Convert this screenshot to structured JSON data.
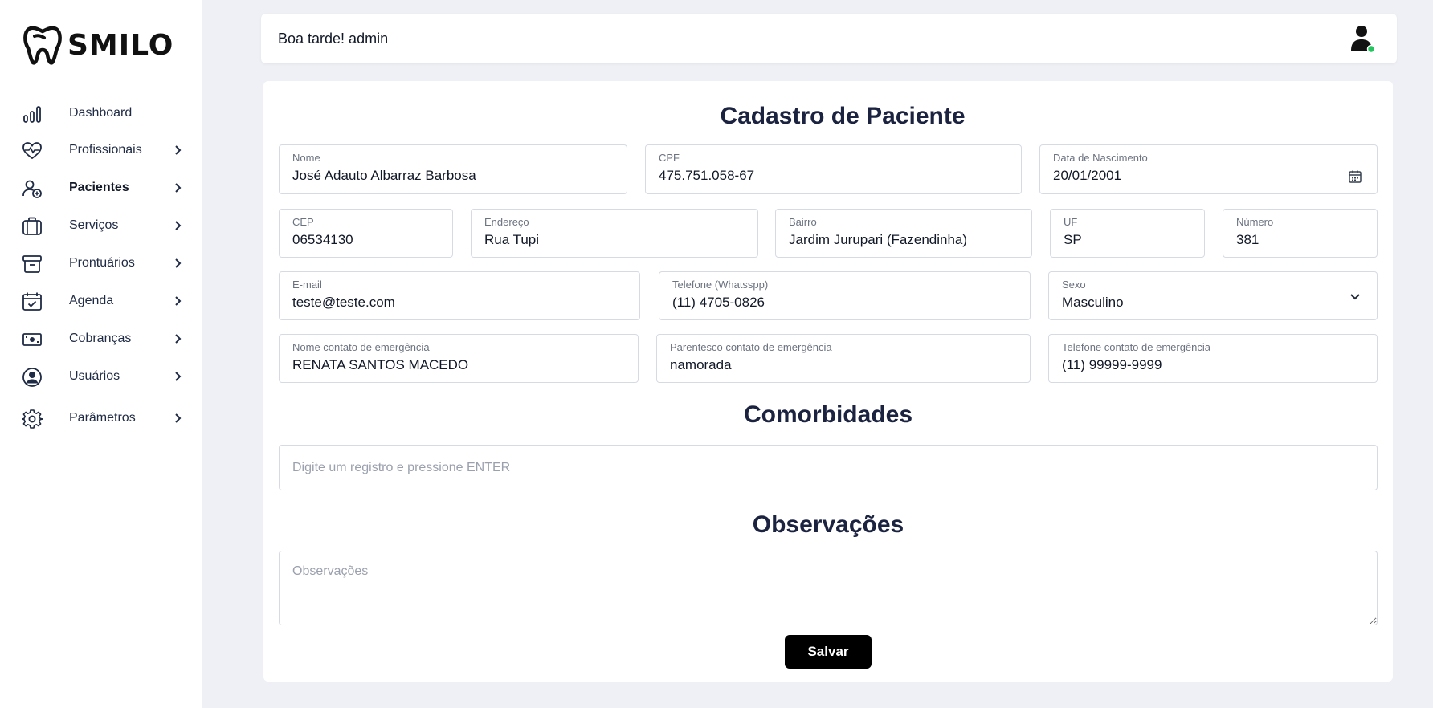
{
  "app": {
    "brand": "SMILO"
  },
  "sidebar": {
    "items": [
      {
        "label": "Dashboard",
        "icon": "chart-bar-icon"
      },
      {
        "label": "Profissionais",
        "icon": "heart-pulse-icon"
      },
      {
        "label": "Pacientes",
        "icon": "user-plus-icon",
        "active": true
      },
      {
        "label": "Serviços",
        "icon": "briefcase-icon"
      },
      {
        "label": "Prontuários",
        "icon": "archive-icon"
      },
      {
        "label": "Agenda",
        "icon": "calendar-check-icon"
      },
      {
        "label": "Cobranças",
        "icon": "banknote-icon"
      },
      {
        "label": "Usuários",
        "icon": "user-circle-icon"
      },
      {
        "label": "Parâmetros",
        "icon": "gear-icon"
      }
    ]
  },
  "header": {
    "greeting": "Boa tarde! admin",
    "user_status_color": "#22c55e"
  },
  "form": {
    "title": "Cadastro de Paciente",
    "fields": {
      "nome": {
        "label": "Nome",
        "value": "José Adauto Albarraz Barbosa"
      },
      "cpf": {
        "label": "CPF",
        "value": "475.751.058-67"
      },
      "nascimento": {
        "label": "Data de Nascimento",
        "value": "20/01/2001"
      },
      "cep": {
        "label": "CEP",
        "value": "06534130"
      },
      "endereco": {
        "label": "Endereço",
        "value": "Rua Tupi"
      },
      "bairro": {
        "label": "Bairro",
        "value": "Jardim Jurupari (Fazendinha)"
      },
      "uf": {
        "label": "UF",
        "value": "SP"
      },
      "numero": {
        "label": "Número",
        "value": "381"
      },
      "email": {
        "label": "E-mail",
        "value": "teste@teste.com"
      },
      "telefone": {
        "label": "Telefone (Whatsspp)",
        "value": "(11) 4705-0826"
      },
      "sexo": {
        "label": "Sexo",
        "value": "Masculino"
      },
      "contato_nome": {
        "label": "Nome contato de emergência",
        "value": "RENATA SANTOS MACEDO"
      },
      "contato_parentesco": {
        "label": "Parentesco contato de emergência",
        "value": "namorada"
      },
      "contato_telefone": {
        "label": "Telefone contato de emergência",
        "value": "(11) 99999-9999"
      }
    },
    "comorbidades": {
      "title": "Comorbidades",
      "placeholder": "Digite um registro e pressione ENTER"
    },
    "observacoes": {
      "title": "Observações",
      "placeholder": "Observações"
    },
    "save_label": "Salvar"
  }
}
